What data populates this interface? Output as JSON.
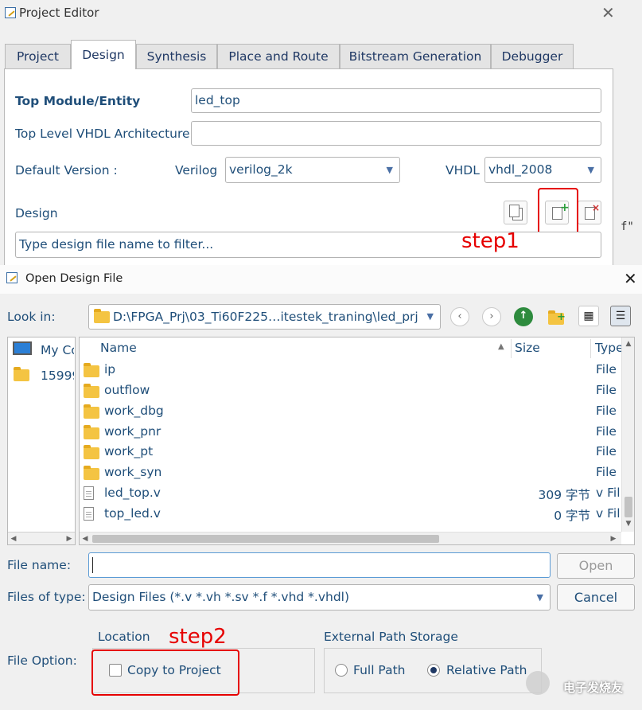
{
  "project_editor": {
    "title": "Project Editor",
    "tabs": [
      {
        "label": "Project"
      },
      {
        "label": "Design"
      },
      {
        "label": "Synthesis"
      },
      {
        "label": "Place and Route"
      },
      {
        "label": "Bitstream Generation"
      },
      {
        "label": "Debugger"
      }
    ],
    "active_tab": "Design",
    "top_module_label": "Top Module/Entity",
    "top_module_value": "led_top",
    "top_vhdl_arch_label": "Top Level VHDL Architecture",
    "top_vhdl_arch_value": "",
    "default_version_label": "Default Version :",
    "verilog_label": "Verilog",
    "verilog_value": "verilog_2k",
    "vhdl_label": "VHDL",
    "vhdl_value": "vhdl_2008",
    "design_label": "Design",
    "filter_placeholder": "Type design file name to filter...",
    "background_code_fragment": "f\"",
    "step1_annotation": "step1"
  },
  "open_design_file": {
    "title": "Open Design File",
    "look_in_label": "Look in:",
    "look_in_path": "D:\\FPGA_Prj\\03_Ti60F225…itestek_traning\\led_prj",
    "places": [
      {
        "label": "My Co",
        "icon": "computer-icon"
      },
      {
        "label": "15999",
        "icon": "folder-icon"
      }
    ],
    "columns": {
      "name": "Name",
      "size": "Size",
      "type": "Type"
    },
    "files": [
      {
        "name": "ip",
        "size": "",
        "type": "File",
        "icon": "folder-icon"
      },
      {
        "name": "outflow",
        "size": "",
        "type": "File",
        "icon": "folder-icon"
      },
      {
        "name": "work_dbg",
        "size": "",
        "type": "File",
        "icon": "folder-icon"
      },
      {
        "name": "work_pnr",
        "size": "",
        "type": "File",
        "icon": "folder-icon"
      },
      {
        "name": "work_pt",
        "size": "",
        "type": "File",
        "icon": "folder-icon"
      },
      {
        "name": "work_syn",
        "size": "",
        "type": "File",
        "icon": "folder-icon"
      },
      {
        "name": "led_top.v",
        "size": "309 字节",
        "type": "v Fil",
        "icon": "file-icon"
      },
      {
        "name": "top_led.v",
        "size": "0 字节",
        "type": "v Fil",
        "icon": "file-icon"
      }
    ],
    "file_name_label": "File name:",
    "file_name_value": "",
    "open_button": "Open",
    "files_of_type_label": "Files of type:",
    "files_of_type_value": "Design Files (*.v *.vh *.sv *.f *.vhd *.vhdl)",
    "cancel_button": "Cancel",
    "file_option_label": "File Option:",
    "location_label": "Location",
    "copy_to_project_label": "Copy to Project",
    "copy_to_project_checked": false,
    "external_path_label": "External Path Storage",
    "full_path_label": "Full Path",
    "relative_path_label": "Relative Path",
    "selected_path_option": "Relative Path",
    "step2_annotation": "step2",
    "watermark": "电子发烧友"
  },
  "colors": {
    "annotation_red": "#e60000",
    "text_blue": "#1f4e79",
    "dialog_bg": "#f0f0f0"
  }
}
